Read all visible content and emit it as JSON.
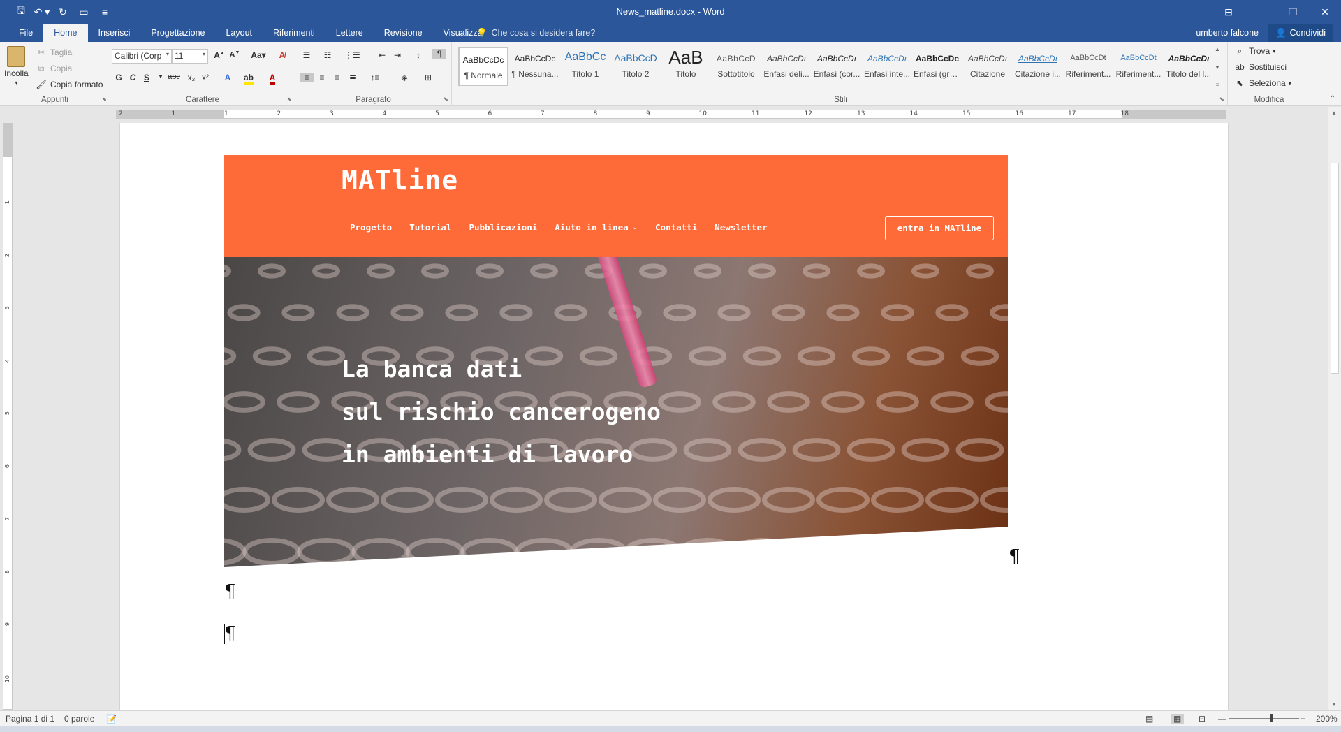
{
  "window": {
    "title": "News_matline.docx - Word"
  },
  "tabs": [
    "File",
    "Home",
    "Inserisci",
    "Progettazione",
    "Layout",
    "Riferimenti",
    "Lettere",
    "Revisione",
    "Visualizza"
  ],
  "tellme": "Che cosa si desidera fare?",
  "account": {
    "user": "umberto falcone",
    "share": "Condividi"
  },
  "ribbon": {
    "clipboard": {
      "paste": "Incolla",
      "cut": "Taglia",
      "copy": "Copia",
      "format_painter": "Copia formato",
      "label": "Appunti"
    },
    "font": {
      "name": "Calibri (Corp",
      "size": "11",
      "case": "Aa",
      "bold": "G",
      "italic": "C",
      "underline": "S",
      "strike": "abc",
      "sub": "x₂",
      "sup": "x²",
      "label": "Carattere"
    },
    "paragraph": {
      "label": "Paragrafo"
    },
    "styles": {
      "label": "Stili",
      "items": [
        {
          "sample": "AaBbCcDc",
          "name": "¶ Normale"
        },
        {
          "sample": "AaBbCcDc",
          "name": "¶ Nessuna..."
        },
        {
          "sample": "AaBbCc",
          "name": "Titolo 1"
        },
        {
          "sample": "AaBbCcD",
          "name": "Titolo 2"
        },
        {
          "sample": "AaB",
          "name": "Titolo"
        },
        {
          "sample": "AaBbCcD",
          "name": "Sottotitolo"
        },
        {
          "sample": "AaBbCcDı",
          "name": "Enfasi deli..."
        },
        {
          "sample": "AaBbCcDı",
          "name": "Enfasi (cor..."
        },
        {
          "sample": "AaBbCcDı",
          "name": "Enfasi inte..."
        },
        {
          "sample": "AaBbCcDc",
          "name": "Enfasi (gra..."
        },
        {
          "sample": "AaBbCcDı",
          "name": "Citazione"
        },
        {
          "sample": "AaBbCcDı",
          "name": "Citazione i..."
        },
        {
          "sample": "AaBbCcDt",
          "name": "Riferiment..."
        },
        {
          "sample": "AaBbCcDt",
          "name": "Riferiment..."
        },
        {
          "sample": "AaBbCcDı",
          "name": "Titolo del l..."
        }
      ]
    },
    "editing": {
      "find": "Trova",
      "replace": "Sostituisci",
      "select": "Seleziona",
      "label": "Modifica"
    }
  },
  "ruler": {
    "h_ticks": [
      "2",
      "1",
      "1",
      "2",
      "3",
      "4",
      "5",
      "6",
      "7",
      "8",
      "9",
      "10",
      "11",
      "12",
      "13",
      "14",
      "15",
      "16",
      "17",
      "18"
    ],
    "v_ticks": [
      "1",
      "2",
      "3",
      "4",
      "5",
      "6",
      "7",
      "8",
      "9",
      "10"
    ]
  },
  "document": {
    "site": {
      "brand": "MATline",
      "nav": [
        "Progetto",
        "Tutorial",
        "Pubblicazioni",
        "Aiuto in linea",
        "Contatti",
        "Newsletter"
      ],
      "nav_dropdown_icon": "chevron-down-icon",
      "login": "entra in MATline",
      "hero_lines": [
        "La banca dati",
        "sul rischio cancerogeno",
        "in ambienti di lavoro"
      ],
      "accent_color": "#fe6a38"
    },
    "pilcrow": "¶"
  },
  "status": {
    "page": "Pagina 1 di 1",
    "words": "0 parole",
    "zoom": "200%"
  }
}
